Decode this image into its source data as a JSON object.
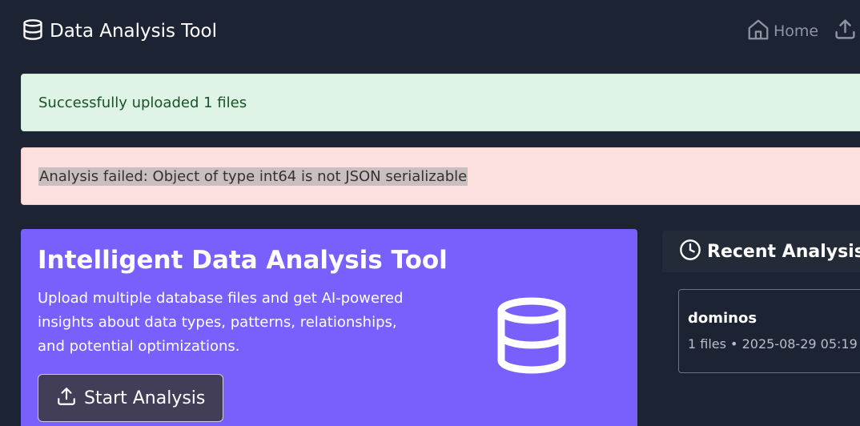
{
  "navbar": {
    "brand_icon": "database-icon",
    "title": "Data Analysis Tool",
    "home_icon": "home-icon",
    "home_label": "Home",
    "upload_icon": "upload-icon"
  },
  "alerts": {
    "success": "Successfully uploaded 1 files",
    "error": "Analysis failed: Object of type int64 is not JSON serializable"
  },
  "hero": {
    "title": "Intelligent Data Analysis Tool",
    "description": "Upload multiple database files and get AI-powered insights about data types, patterns, relationships, and potential optimizations.",
    "button_label": "Start Analysis",
    "button_icon": "upload-icon",
    "illustration_icon": "database-icon"
  },
  "recent": {
    "title": "Recent Analysis S",
    "icon": "clock-icon",
    "items": [
      {
        "name": "dominos",
        "meta": "1 files • 2025-08-29 05:19"
      }
    ]
  },
  "colors": {
    "background": "#1c2333",
    "hero": "#7960fd",
    "success_bg": "#dff4e6",
    "error_bg": "#fde0e0"
  }
}
